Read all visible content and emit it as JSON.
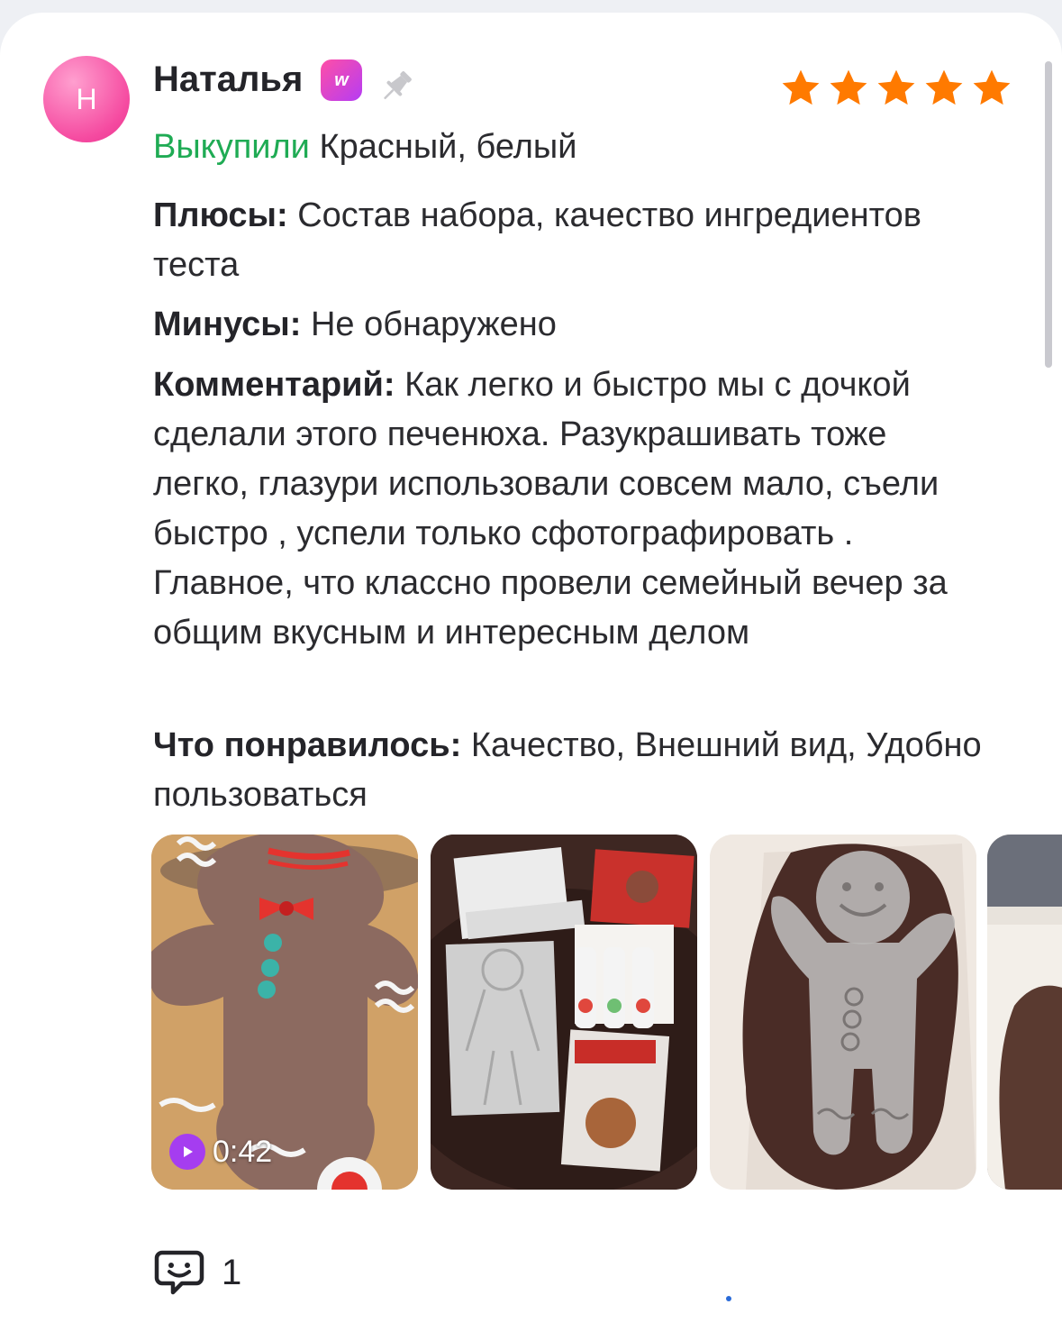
{
  "review": {
    "avatar_letter": "Н",
    "author": "Наталья",
    "badge_icon": "wb-club-badge-icon",
    "pin_icon": "pin-icon",
    "rating": 5,
    "status": "Выкупили",
    "color": "Красный, белый",
    "pros_label": "Плюсы:",
    "pros_text": "Состав набора, качество ингредиентов теста",
    "cons_label": "Минусы:",
    "cons_text": "Не обнаружено",
    "comment_label": "Комментарий:",
    "comment_text": "Как легко и быстро мы с дочкой сделали этого печенюха. Разукрашивать тоже легко, глазури использовали совсем мало, съели быстро , успели только сфотографировать . Главное, что классно провели семейный вечер за общим вкусным и интересным делом",
    "liked_label": "Что понравилось:",
    "liked_text": "Качество, Внешний вид, Удобно пользоваться"
  },
  "media": {
    "video_duration": "0:42",
    "play_icon": "play-icon",
    "thumbnails": [
      "decorated-gingerbread-video",
      "kit-contents-photo",
      "stencil-on-dough-photo",
      "partial-photo"
    ]
  },
  "comments": {
    "icon": "comment-bubble-icon",
    "count": "1"
  },
  "colors": {
    "star": "#ff7a00",
    "status_green": "#1fab54",
    "avatar": "#f54aa0",
    "play": "#a53df0"
  }
}
